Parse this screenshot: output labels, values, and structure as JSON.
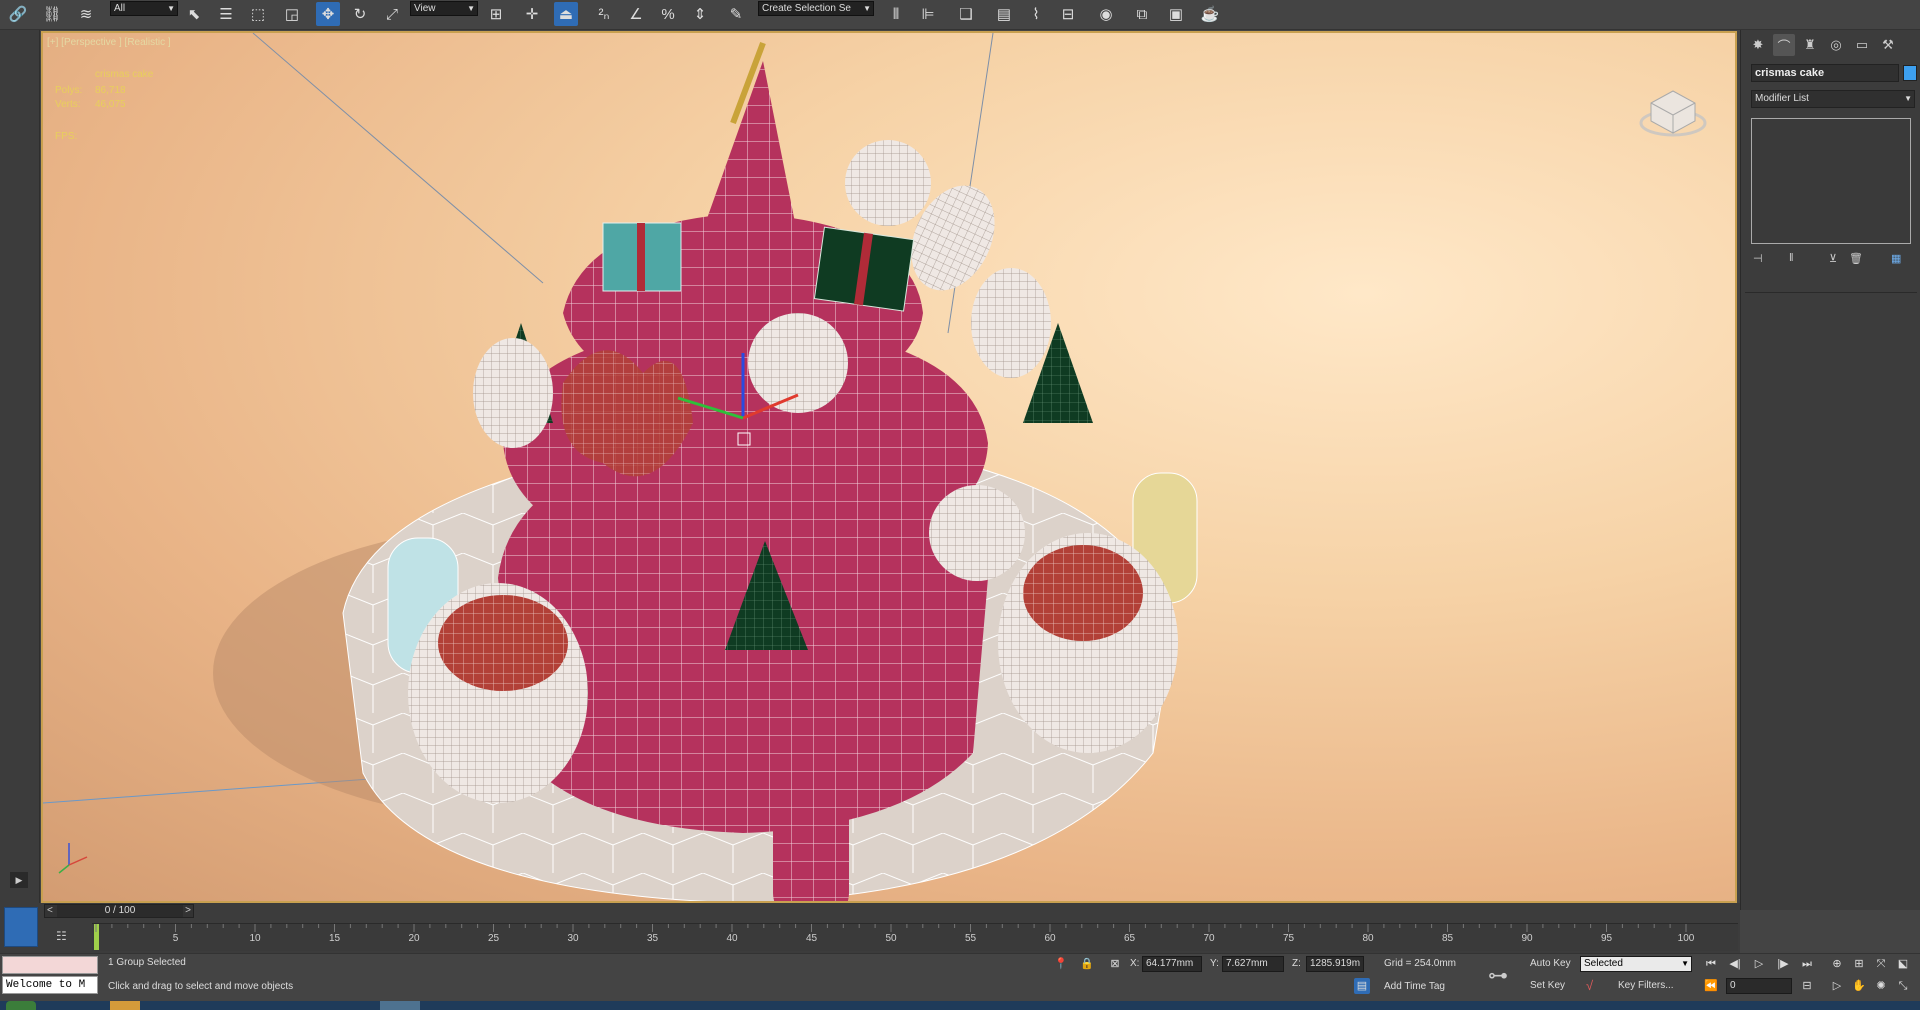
{
  "toolbar": {
    "selection_filter": "All",
    "reference_coord": "View",
    "named_selection_placeholder": "Create Selection Se"
  },
  "viewport": {
    "label": "[+] [Perspective ] [Realistic ]",
    "object_name": "crismas cake",
    "polys_label": "Polys:",
    "polys_value": "86,718",
    "verts_label": "Verts:",
    "verts_value": "46,075",
    "fps_label": "FPS:"
  },
  "command_panel": {
    "object_name": "crismas cake",
    "modifier_list": "Modifier List",
    "object_color": "#3da0f0"
  },
  "timeline": {
    "frame_display": "0 / 100",
    "prev": "<",
    "next": ">",
    "ticks": [
      "5",
      "10",
      "15",
      "20",
      "25",
      "30",
      "35",
      "40",
      "45",
      "50",
      "55",
      "60",
      "65",
      "70",
      "75",
      "80",
      "85",
      "90",
      "95",
      "100"
    ]
  },
  "status": {
    "selection_info": "1 Group Selected",
    "prompt": "Click and drag to select and move objects",
    "script_listener": "Welcome to M",
    "x_label": "X:",
    "x_value": "64.177mm",
    "y_label": "Y:",
    "y_value": "7.627mm",
    "z_label": "Z:",
    "z_value": "1285.919m",
    "grid": "Grid = 254.0mm",
    "add_time_tag": "Add Time Tag",
    "auto_key": "Auto Key",
    "set_key": "Set Key",
    "key_mode": "Selected",
    "key_filters": "Key Filters...",
    "current_frame": "0"
  },
  "colors": {
    "accent": "#2f6cb5",
    "viewport_border": "#c8a050",
    "stats_text": "#e8cf5c",
    "cake_pink": "#b5325d",
    "tree_green": "#0f3b22",
    "gift_teal": "#4fa7a5"
  }
}
